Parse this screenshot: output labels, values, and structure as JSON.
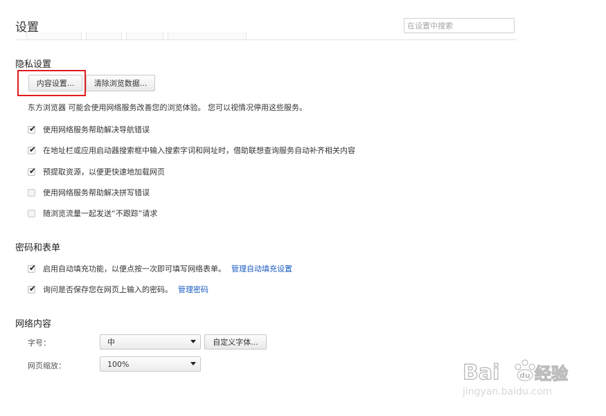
{
  "header": {
    "title": "设置",
    "search_placeholder": "在设置中搜索"
  },
  "privacy": {
    "title": "隐私设置",
    "content_settings_button": "内容设置...",
    "clear_data_button": "清除浏览数据...",
    "description": "东方浏览器 可能会使用网络服务改善您的浏览体验。 您可以视情况停用这些服务。",
    "options": [
      {
        "label": "使用网络服务帮助解决导航错误",
        "checked": true
      },
      {
        "label": "在地址栏或应用启动器搜索框中输入搜索字词和网址时，借助联想查询服务自动补齐相关内容",
        "checked": true
      },
      {
        "label": "预提取资源，以便更快速地加载网页",
        "checked": true
      },
      {
        "label": "使用网络服务帮助解决拼写错误",
        "checked": false
      },
      {
        "label": "随浏览流量一起发送“不跟踪”请求",
        "checked": false
      }
    ]
  },
  "passwords": {
    "title": "密码和表单",
    "options": [
      {
        "label": "启用自动填充功能，以便点按一次即可填写网络表单。",
        "link": "管理自动填充设置",
        "checked": true
      },
      {
        "label": "询问是否保存您在网页上输入的密码。",
        "link": "管理密码",
        "checked": true
      }
    ]
  },
  "web_content": {
    "title": "网络内容",
    "font_size_label": "字号：",
    "font_size_value": "中",
    "customize_fonts_button": "自定义字体...",
    "zoom_label": "网页缩放：",
    "zoom_value": "100%"
  },
  "watermark": {
    "brand": "Bai",
    "brand_suffix": "经验",
    "url": "jingyan.baidu.com"
  }
}
